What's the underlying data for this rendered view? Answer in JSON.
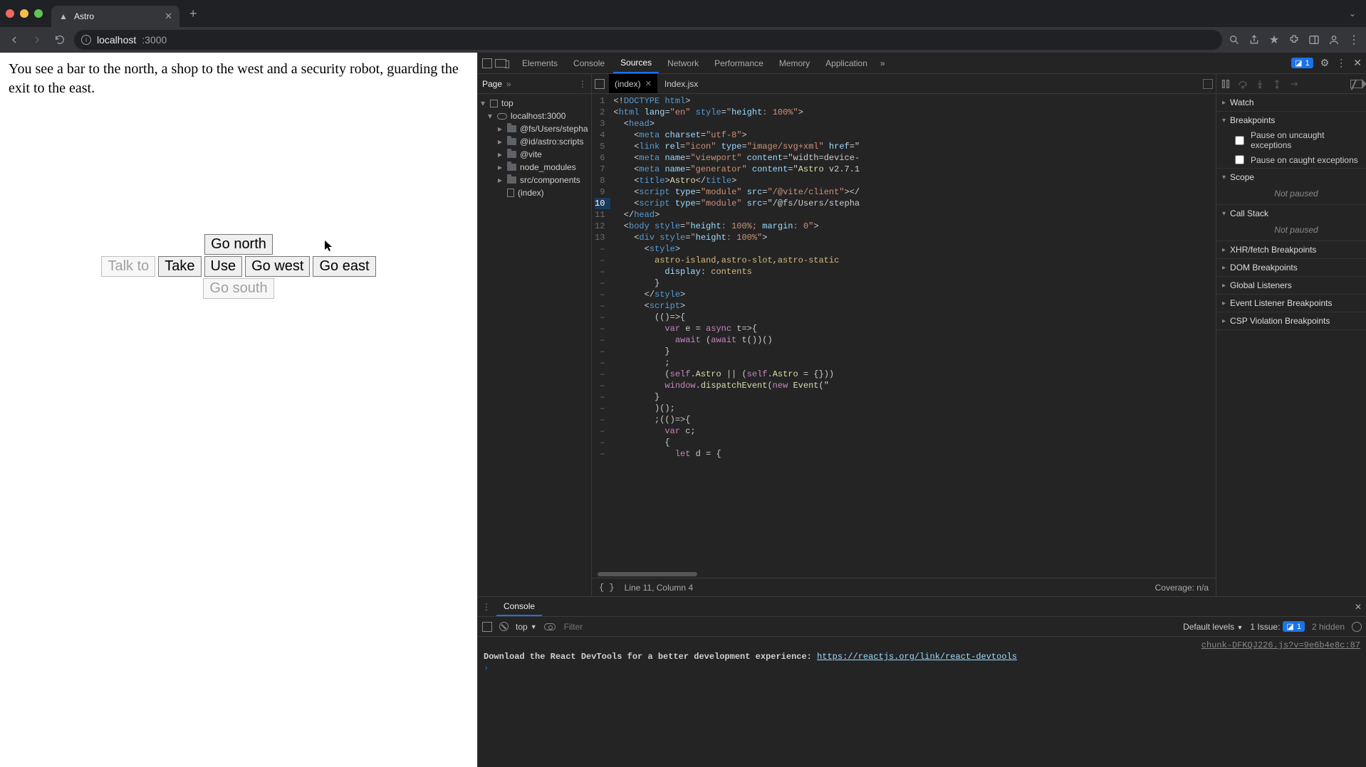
{
  "browser": {
    "tab_title": "Astro",
    "url_host": "localhost",
    "url_path": ":3000"
  },
  "game": {
    "narrative": "You see a bar to the north, a shop to the west and a security robot, guarding the exit to the east.",
    "btn_talk": "Talk to",
    "btn_take": "Take",
    "btn_use": "Use",
    "btn_north": "Go north",
    "btn_west": "Go west",
    "btn_east": "Go east",
    "btn_south": "Go south"
  },
  "devtools": {
    "tabs": {
      "elements": "Elements",
      "console": "Console",
      "sources": "Sources",
      "network": "Network",
      "performance": "Performance",
      "memory": "Memory",
      "application": "Application"
    },
    "issues_badge": "1",
    "sources": {
      "nav_page": "Page",
      "tree": {
        "top": "top",
        "host": "localhost:3000",
        "f1": "@fs/Users/stepha",
        "f2": "@id/astro:scripts",
        "f3": "@vite",
        "f4": "node_modules",
        "f5": "src/components",
        "file_index": "(index)"
      },
      "open_tabs": {
        "t1": "(index)",
        "t2": "Index.jsx"
      },
      "code_lines": [
        "<!DOCTYPE html>",
        "<html lang=\"en\" style=\"height: 100%\">",
        "  <head>",
        "    <meta charset=\"utf-8\">",
        "    <link rel=\"icon\" type=\"image/svg+xml\" href=\"",
        "    <meta name=\"viewport\" content=\"width=device-",
        "    <meta name=\"generator\" content=\"Astro v2.7.1",
        "    <title>Astro</title>",
        "    <script type=\"module\" src=\"/@vite/client\"></",
        "    <script type=\"module\" src=\"/@fs/Users/stepha",
        "  </head>",
        "  <body style=\"height: 100%; margin: 0\">",
        "    <div style=\"height: 100%\">",
        "      <style>",
        "        astro-island,astro-slot,astro-static",
        "          display: contents",
        "        }",
        "      </style>",
        "      <script>",
        "        (()=>{",
        "          var e = async t=>{",
        "            await (await t())()",
        "          }",
        "          ;",
        "          (self.Astro || (self.Astro = {}))",
        "          window.dispatchEvent(new Event(\"",
        "        }",
        "        )();",
        "        ;(()=>{",
        "          var c;",
        "          {",
        "            let d = {"
      ],
      "line_numbers": [
        "1",
        "2",
        "3",
        "4",
        "5",
        "6",
        "7",
        "8",
        "9",
        "10",
        "11",
        "12",
        "13",
        "–",
        "–",
        "–",
        "–",
        "–",
        "–",
        "–",
        "–",
        "–",
        "–",
        "–",
        "–",
        "–",
        "–",
        "–",
        "–",
        "–",
        "–",
        "–"
      ],
      "status_line": "Line 11, Column 4",
      "coverage": "Coverage: n/a"
    },
    "debugger": {
      "watch": "Watch",
      "breakpoints": "Breakpoints",
      "pause_uncaught": "Pause on uncaught exceptions",
      "pause_caught": "Pause on caught exceptions",
      "scope": "Scope",
      "scope_body": "Not paused",
      "callstack": "Call Stack",
      "callstack_body": "Not paused",
      "xhr": "XHR/fetch Breakpoints",
      "dom": "DOM Breakpoints",
      "global": "Global Listeners",
      "event": "Event Listener Breakpoints",
      "csp": "CSP Violation Breakpoints"
    },
    "console_drawer": {
      "title": "Console",
      "context": "top",
      "filter_placeholder": "Filter",
      "levels": "Default levels",
      "issue_label": "1 Issue:",
      "issue_count": "1",
      "hidden": "2 hidden",
      "msg_src": "chunk-DFKQJ226.js?v=9e6b4e8c:87",
      "msg_text": "Download the React DevTools for a better development experience: ",
      "msg_link": "https://reactjs.org/link/react-devtools"
    }
  }
}
